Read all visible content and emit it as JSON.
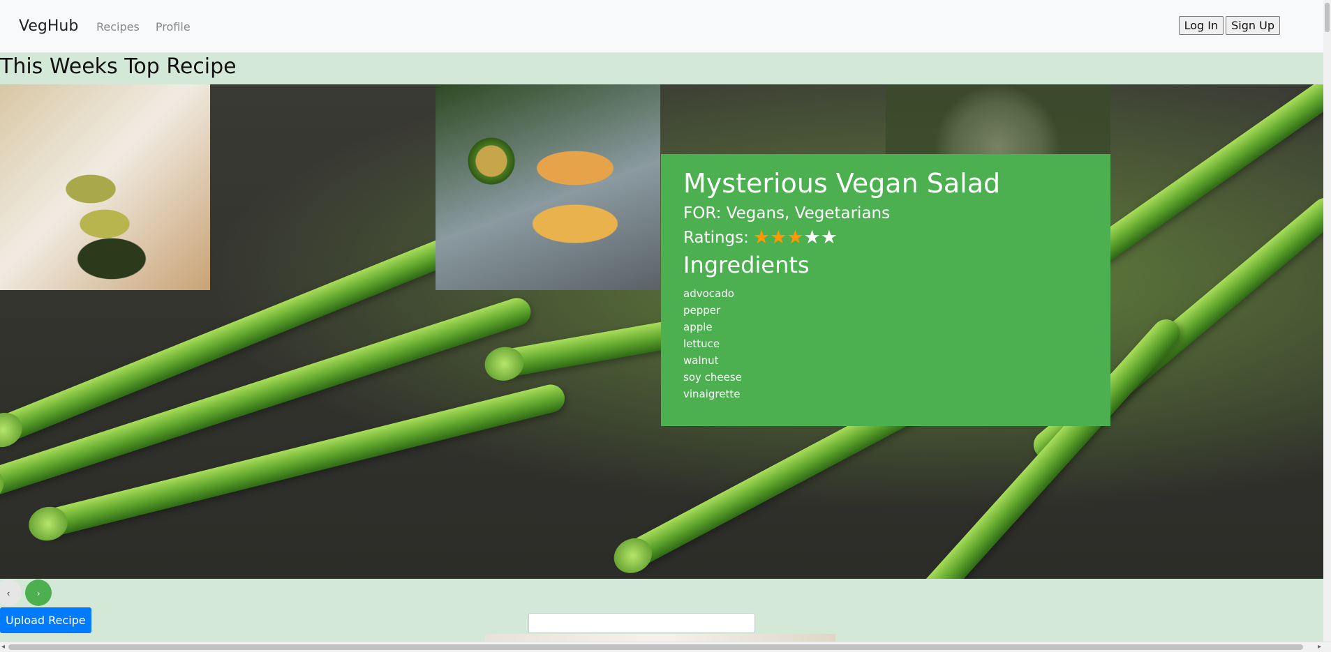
{
  "nav": {
    "brand": "VegHub",
    "links": [
      "Recipes",
      "Profile"
    ],
    "login_label": "Log In",
    "signup_label": "Sign Up"
  },
  "section_title": "This Weeks Top Recipe",
  "recipe": {
    "title": "Mysterious Vegan Salad",
    "for_text": "FOR: Vegans, Vegetarians",
    "ratings_label": "Ratings:",
    "rating": 3,
    "rating_max": 5,
    "ingredients_heading": "Ingredients",
    "ingredients": [
      "advocado",
      "pepper",
      "apple",
      "lettuce",
      "walnut",
      "soy cheese",
      "vinaigrette"
    ]
  },
  "carousel": {
    "prev": "‹",
    "next": "›"
  },
  "upload_label": "Upload Recipe",
  "colors": {
    "card": "#4caf50",
    "star_on": "#ff9800",
    "upload": "#007bff",
    "page_bg": "#d4e8d8"
  }
}
